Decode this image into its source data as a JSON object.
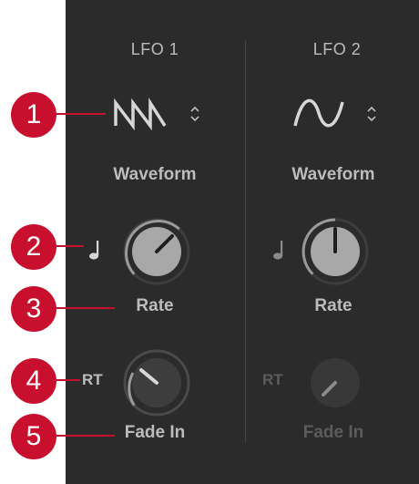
{
  "lfo1": {
    "title": "LFO 1",
    "waveform_icon": "sawtooth-wave-icon",
    "waveform_label": "Waveform",
    "rate_sync_icon": "quarter-note-icon",
    "rate_label": "Rate",
    "fade_mode_label": "RT",
    "fade_label": "Fade In",
    "fade_enabled": true
  },
  "lfo2": {
    "title": "LFO 2",
    "waveform_icon": "sine-wave-icon",
    "waveform_label": "Waveform",
    "rate_sync_icon": "quarter-note-icon",
    "rate_label": "Rate",
    "fade_mode_label": "RT",
    "fade_label": "Fade In",
    "fade_enabled": false
  },
  "callouts": [
    "1",
    "2",
    "3",
    "4",
    "5"
  ],
  "colors": {
    "panel": "#2b2b2b",
    "text": "#bcbcbc",
    "text_disabled": "#5c5c5c",
    "callout": "#c8102e"
  }
}
